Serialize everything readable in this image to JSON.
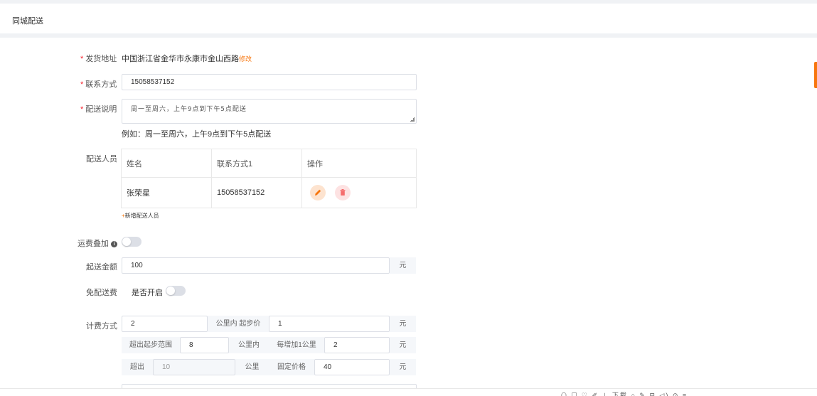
{
  "header": {
    "title": "同城配送"
  },
  "form": {
    "ship_address": {
      "label": "发货地址",
      "value": "中国浙江省金华市永康市金山西路",
      "edit_link": "修改"
    },
    "contact": {
      "label": "联系方式",
      "value": "15058537152"
    },
    "delivery_note": {
      "label": "配送说明",
      "value": "周一至周六，上午9点到下午5点配送",
      "example": "例如：周一至周六，上午9点到下午5点配送"
    },
    "staff": {
      "label": "配送人员",
      "columns": [
        "姓名",
        "联系方式1",
        "操作"
      ],
      "rows": [
        {
          "name": "张荣星",
          "phone": "15058537152"
        }
      ],
      "add_label": "新增配送人员",
      "add_plus": "+"
    },
    "fee_stack": {
      "label": "运费叠加",
      "info": "i",
      "enabled": false
    },
    "min_amount": {
      "label": "起送金额",
      "value": "100",
      "unit": "元"
    },
    "free_shipping": {
      "label": "免配送费",
      "toggle_label": "是否开启",
      "enabled": false
    },
    "billing": {
      "label": "计费方式",
      "row1": {
        "km": "2",
        "mid_label": "公里内 起步价",
        "start_price": "1",
        "unit": "元"
      },
      "row2": {
        "prefix": "超出起步范围",
        "km": "8",
        "mid_label": "公里内",
        "per_label": "每增加1公里",
        "per_price": "2",
        "unit": "元"
      },
      "row3": {
        "prefix": "超出",
        "km": "10",
        "km_label": "公里",
        "fixed_label": "固定价格",
        "fixed_price": "40",
        "unit": "元"
      }
    }
  },
  "bottom_bar": {
    "tools": "⎔ ☐ ♡ ✐ ⊥ 下载 ⌂ ✎ ⊟ ◁) ⊙ ≡"
  },
  "colors": {
    "accent": "#f7760e",
    "required": "#f5222d",
    "delete": "#f56c6c"
  }
}
